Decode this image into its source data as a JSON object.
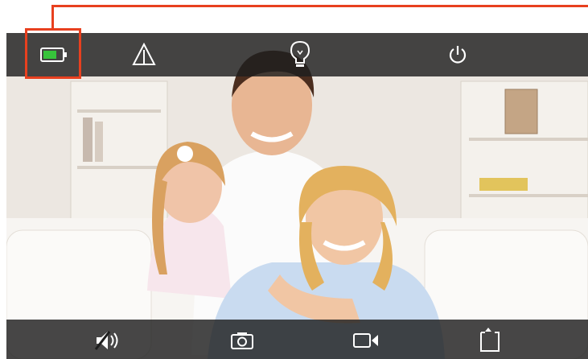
{
  "screen": {
    "top_bar": {
      "icons": [
        "battery-icon",
        "warning-icon",
        "light-bulb-icon",
        "power-icon"
      ]
    },
    "bottom_bar": {
      "icons": [
        "mute-speaker-icon",
        "camera-icon",
        "video-record-icon",
        "exit-icon"
      ]
    },
    "photo": {
      "description_icon": "family-photo"
    }
  },
  "annotation": {
    "color": "#e8401f",
    "highlighted": "battery-icon"
  },
  "colors": {
    "bar": "#1e1e1e",
    "battery_fill": "#37c43b",
    "icon": "#ffffff"
  }
}
